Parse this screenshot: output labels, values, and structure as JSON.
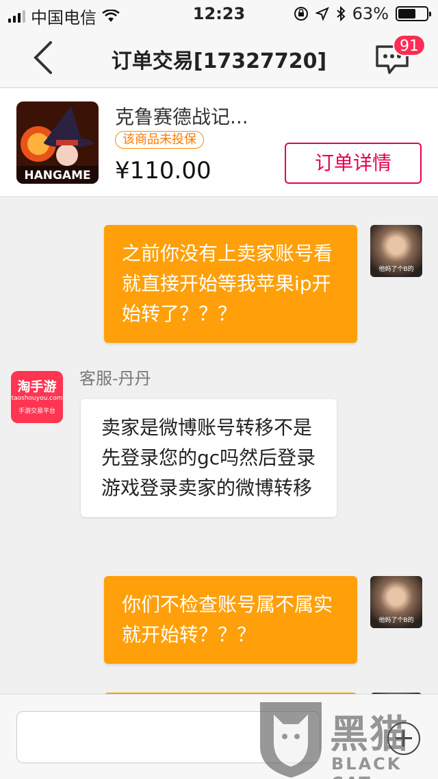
{
  "status_bar": {
    "carrier": "中国电信",
    "time": "12:23",
    "battery_percent": "63%",
    "battery_level": 0.63
  },
  "header": {
    "title": "订单交易[17327720]",
    "message_badge": "91"
  },
  "product": {
    "thumbnail_label": "HANGAME",
    "name": "克鲁赛德战记...",
    "insurance_tag": "该商品未投保",
    "price": "¥110.00",
    "detail_button": "订单详情"
  },
  "messages": [
    {
      "side": "right",
      "text": "之前你没有上卖家账号看就直接开始等我苹果ip开始转了？？？"
    },
    {
      "side": "left",
      "sender": "客服-丹丹",
      "text": "卖家是微博账号转移不是先登录您的gc吗然后登录游戏登录卖家的微博转移"
    },
    {
      "side": "right",
      "text": "你们不检查账号属不属实 就开始转？？？"
    }
  ],
  "avatars": {
    "user_caption": "他妈了个B的",
    "cs_logo_title": "淘手游",
    "cs_logo_url": "taoshouyou.com",
    "cs_logo_sub": "手游交易平台"
  },
  "watermark": {
    "cn": "黑猫",
    "en": "BLACK CAT"
  },
  "colors": {
    "accent_orange": "#ffa00a",
    "accent_red": "#e6004c",
    "badge_red": "#ff2d55"
  }
}
